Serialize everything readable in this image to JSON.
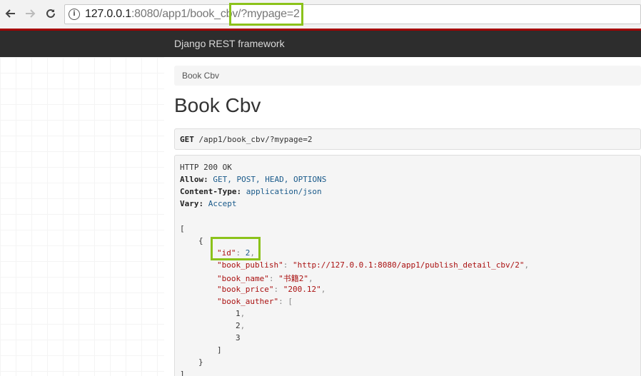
{
  "browser": {
    "url_host": "127.0.0.1",
    "url_rest": ":8080/app1/book_cbv",
    "url_query": "/?mypage=2"
  },
  "navbar": {
    "brand": "Django REST framework"
  },
  "breadcrumb": {
    "label": "Book Cbv"
  },
  "page": {
    "title": "Book Cbv"
  },
  "request": {
    "method": "GET",
    "path": "/app1/book_cbv/?mypage=2"
  },
  "response": {
    "status": "HTTP 200 OK",
    "headers": [
      {
        "name": "Allow:",
        "value": "GET, POST, HEAD, OPTIONS"
      },
      {
        "name": "Content-Type:",
        "value": "application/json"
      },
      {
        "name": "Vary:",
        "value": "Accept"
      }
    ],
    "body": {
      "open_bracket": "[",
      "open_brace": "{",
      "id_key": "\"id\"",
      "id_value": "2",
      "publish_key": "\"book_publish\"",
      "publish_value": "\"http://127.0.0.1:8080/app1/publish_detail_cbv/2\"",
      "name_key": "\"book_name\"",
      "name_value": "\"书籍2\"",
      "price_key": "\"book_price\"",
      "price_value": "\"200.12\"",
      "auther_key": "\"book_auther\"",
      "auther_open": "[",
      "auther_values": [
        "1",
        "2",
        "3"
      ],
      "auther_close": "]",
      "close_brace": "}",
      "close_bracket": "]"
    }
  },
  "colors": {
    "navbar": "#2d2d2d",
    "accent_red": "#a30000",
    "highlight": "#8bc21a"
  },
  "icons": [
    "back-arrow-icon",
    "forward-arrow-icon",
    "reload-icon",
    "info-icon"
  ]
}
